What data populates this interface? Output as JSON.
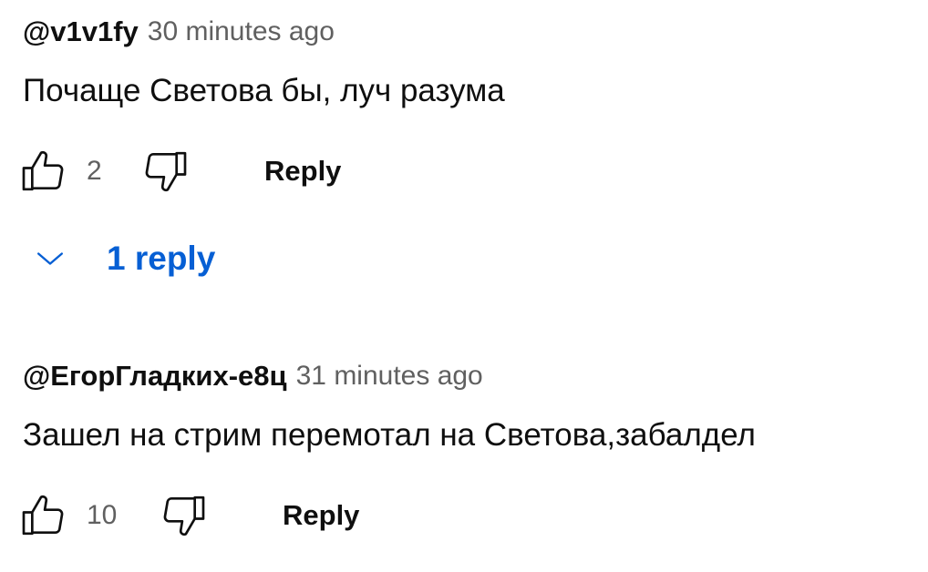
{
  "comments": [
    {
      "author": "@v1v1fy",
      "time": "30 minutes ago",
      "text": "Почаще Светова бы, луч разума",
      "likes": "2",
      "reply_label": "Reply"
    },
    {
      "author": "@ЕгорГладких-е8ц",
      "time": "31 minutes ago",
      "text": "Зашел на стрим перемотал на Светова,забалдел",
      "likes": "10",
      "reply_label": "Reply"
    }
  ],
  "replies_toggle": {
    "label": "1 reply",
    "icon": "chevron-down-icon"
  },
  "icons": {
    "like": "thumbs-up-icon",
    "dislike": "thumbs-down-icon"
  },
  "colors": {
    "text": "#0f0f0f",
    "secondary": "#606060",
    "link": "#065fd4",
    "background": "#ffffff"
  }
}
